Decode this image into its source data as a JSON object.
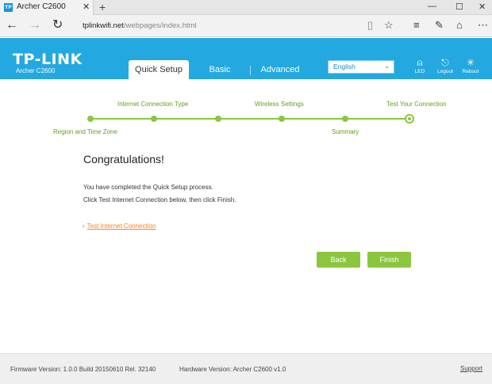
{
  "browser": {
    "tab_title": "Archer C2600",
    "favicon_text": "TP",
    "tab_close": "✕",
    "new_tab": "+",
    "window_min": "—",
    "window_max": "☐",
    "window_close": "✕",
    "url_host": "tplinkwifi.net",
    "url_path": "/webpages/index.html"
  },
  "header": {
    "logo": "TP-LINK",
    "model": "Archer C2600",
    "tabs": [
      "Quick Setup",
      "Basic",
      "Advanced"
    ],
    "language": "English",
    "buttons": [
      {
        "label": "LED",
        "icon": "led-icon"
      },
      {
        "label": "Logout",
        "icon": "logout-icon"
      },
      {
        "label": "Reboot",
        "icon": "reboot-icon"
      }
    ]
  },
  "progress": {
    "steps": [
      "Region and Time Zone",
      "Internet Connection Type",
      "Wireless Settings",
      "Summary",
      "Test Your Connection"
    ],
    "current_step": 5
  },
  "content": {
    "heading": "Congratulations!",
    "line1": "You have completed the Quick Setup process.",
    "line2": "Click Test Internet Connection below, then click Finish.",
    "test_link": "Test Internet Connection",
    "back_label": "Back",
    "finish_label": "Finish"
  },
  "footer": {
    "firmware": "Firmware Version: 1.0.0 Build 20150610 Rel. 32140",
    "hardware": "Hardware Version: Archer C2600 v1.0",
    "support": "Support"
  },
  "colors": {
    "brand_blue": "#23a8e0",
    "accent_green": "#8cc63f",
    "link_orange": "#f58220"
  }
}
